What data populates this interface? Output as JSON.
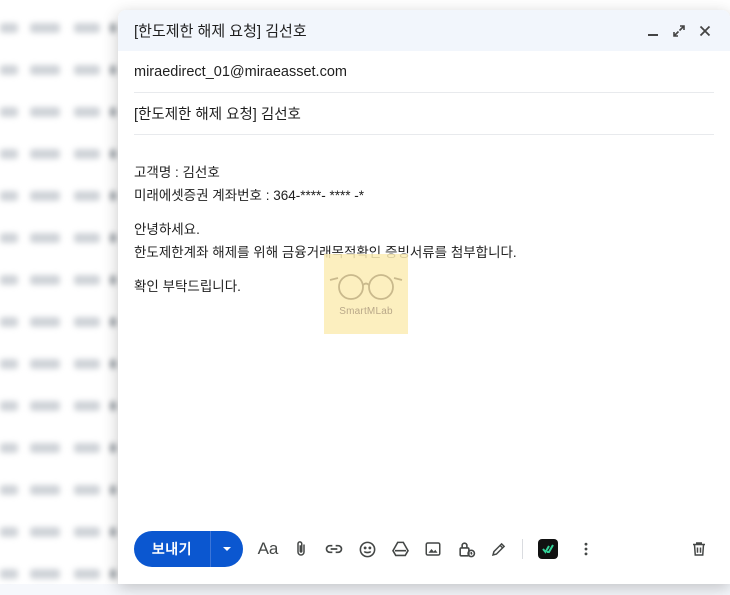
{
  "compose": {
    "title": "[한도제한 해제 요청] 김선호",
    "to": "miraedirect_01@miraeasset.com",
    "subject": "[한도제한 해제 요청] 김선호",
    "body": {
      "line1": "고객명 : 김선호",
      "line2": "미래에셋증권 계좌번호 : 364-****- ****  -*",
      "line3": "안녕하세요.",
      "line4": "한도제한계좌 해제를 위해 금융거래목적확인 증빙서류를 첨부합니다.",
      "line5": "확인 부탁드립니다."
    },
    "watermark": "SmartMLab",
    "send_label": "보내기",
    "format_label": "Aa"
  },
  "icons": {
    "minimize": "minimize-icon",
    "expand": "expand-icon",
    "close": "close-icon",
    "dropdown": "chevron-down-icon",
    "attach": "paperclip-icon",
    "link": "link-icon",
    "emoji": "emoji-icon",
    "drive": "drive-icon",
    "photo": "image-icon",
    "confidential": "lock-clock-icon",
    "signature": "pen-icon",
    "extension": "checkmark-extension-icon",
    "more": "more-vert-icon",
    "trash": "trash-icon"
  },
  "colors": {
    "send_button": "#0b57d0",
    "header_bg": "#f2f6fc"
  }
}
